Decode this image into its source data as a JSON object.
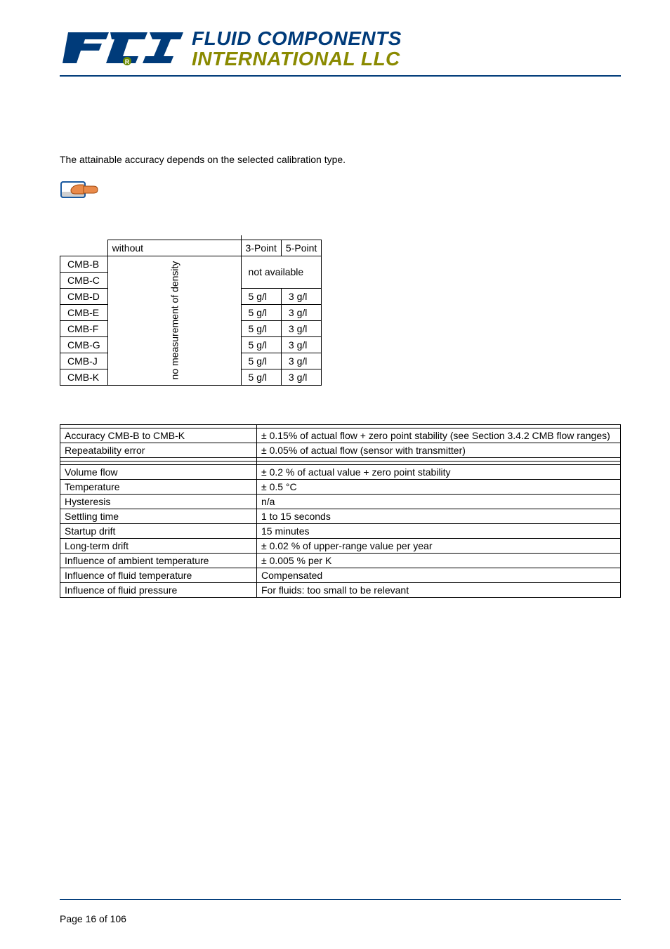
{
  "header": {
    "logo_line1": "FLUID COMPONENTS",
    "logo_line2": "INTERNATIONAL LLC"
  },
  "intro_text": "The attainable accuracy depends on the selected calibration type.",
  "small_table": {
    "col_without": "without",
    "col_3point": "3-Point",
    "col_5point": "5-Point",
    "rows": [
      {
        "model": "CMB-B"
      },
      {
        "model": "CMB-C"
      },
      {
        "model": "CMB-D",
        "p3": "5 g/l",
        "p5": "3 g/l"
      },
      {
        "model": "CMB-E",
        "p3": "5 g/l",
        "p5": "3 g/l"
      },
      {
        "model": "CMB-F",
        "p3": "5 g/l",
        "p5": "3 g/l"
      },
      {
        "model": "CMB-G",
        "p3": "5 g/l",
        "p5": "3 g/l"
      },
      {
        "model": "CMB-J",
        "p3": "5 g/l",
        "p5": "3 g/l"
      },
      {
        "model": "CMB-K",
        "p3": "5 g/l",
        "p5": "3 g/l"
      }
    ],
    "not_available": "not available",
    "vertical_label": "no measurement of density"
  },
  "big_table": {
    "rows": [
      {
        "label": "Accuracy CMB-B to CMB-K",
        "value": "± 0.15% of actual flow + zero point stability (see Section 3.4.2 CMB flow ranges)"
      },
      {
        "label": "Repeatability error",
        "value": "± 0.05% of actual flow (sensor with transmitter)"
      },
      {
        "label": "",
        "value": ""
      },
      {
        "label": "",
        "value": ""
      },
      {
        "label": "Volume flow",
        "value": "± 0.2 % of actual value + zero point stability"
      },
      {
        "label": "Temperature",
        "value": "± 0.5 °C"
      },
      {
        "label": "Hysteresis",
        "value": "n/a"
      },
      {
        "label": "Settling time",
        "value": "1 to 15 seconds"
      },
      {
        "label": "Startup drift",
        "value": "15 minutes"
      },
      {
        "label": "Long-term drift",
        "value": "± 0.02 % of upper-range value per year"
      },
      {
        "label": "Influence of ambient temperature",
        "value": "± 0.005 % per K"
      },
      {
        "label": "Influence of fluid temperature",
        "value": "Compensated"
      },
      {
        "label": "Influence of fluid pressure",
        "value": "For fluids: too small to be relevant"
      }
    ]
  },
  "footer": {
    "page_label": "Page 16 of 106"
  }
}
